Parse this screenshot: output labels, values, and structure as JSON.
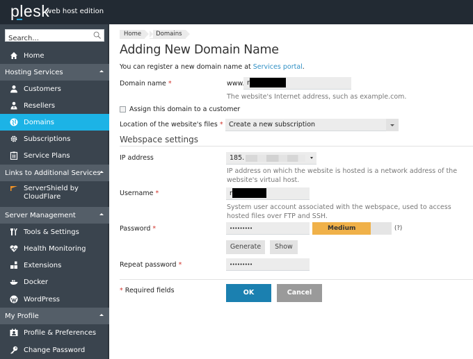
{
  "header": {
    "logo": "plesk",
    "edition": "web host edition"
  },
  "sidebar": {
    "search_placeholder": "Search...",
    "home": "Home",
    "sections": [
      {
        "label": "Hosting Services",
        "items": [
          "Customers",
          "Resellers",
          "Domains",
          "Subscriptions",
          "Service Plans"
        ]
      },
      {
        "label": "Links to Additional Services",
        "items": [
          "ServerShield by CloudFlare"
        ]
      },
      {
        "label": "Server Management",
        "items": [
          "Tools & Settings",
          "Health Monitoring",
          "Extensions",
          "Docker",
          "WordPress"
        ]
      },
      {
        "label": "My Profile",
        "items": [
          "Profile & Preferences",
          "Change Password"
        ]
      }
    ],
    "active_item": "Domains"
  },
  "breadcrumb": [
    "Home",
    "Domains"
  ],
  "page": {
    "title": "Adding New Domain Name",
    "intro_text": "You can register a new domain name at ",
    "intro_link": "Services portal",
    "intro_end": "."
  },
  "form": {
    "domain_label": "Domain name",
    "domain_prefix": "www.",
    "domain_value": "r",
    "domain_hint": "The website's Internet address, such as example.com.",
    "assign_checkbox": "Assign this domain to a customer",
    "assign_checked": false,
    "location_label": "Location of the website's files",
    "location_value": "Create a new subscription",
    "webspace_title": "Webspace settings",
    "ip_label": "IP address",
    "ip_value": "185.",
    "ip_hint": "IP address on which the website is hosted is a network address of the website's virtual host.",
    "username_label": "Username",
    "username_value": "r",
    "username_hint": "System user account associated with the webspace, used to access hosted files over FTP and SSH.",
    "password_label": "Password",
    "password_value": "•••••••••",
    "strength_label": "Medium",
    "strength_fraction": 0.74,
    "help_mark": "(?)",
    "generate_button": "Generate",
    "show_button": "Show",
    "repeat_label": "Repeat password",
    "repeat_value": "•••••••••",
    "required_star": "*",
    "required_note": "Required fields",
    "ok_button": "OK",
    "cancel_button": "Cancel"
  },
  "colors": {
    "accent": "#1cb3e6",
    "primary_button": "#1b80b0",
    "strength_medium": "#f0b149",
    "required": "#d0342c",
    "link": "#2f8fc4"
  }
}
